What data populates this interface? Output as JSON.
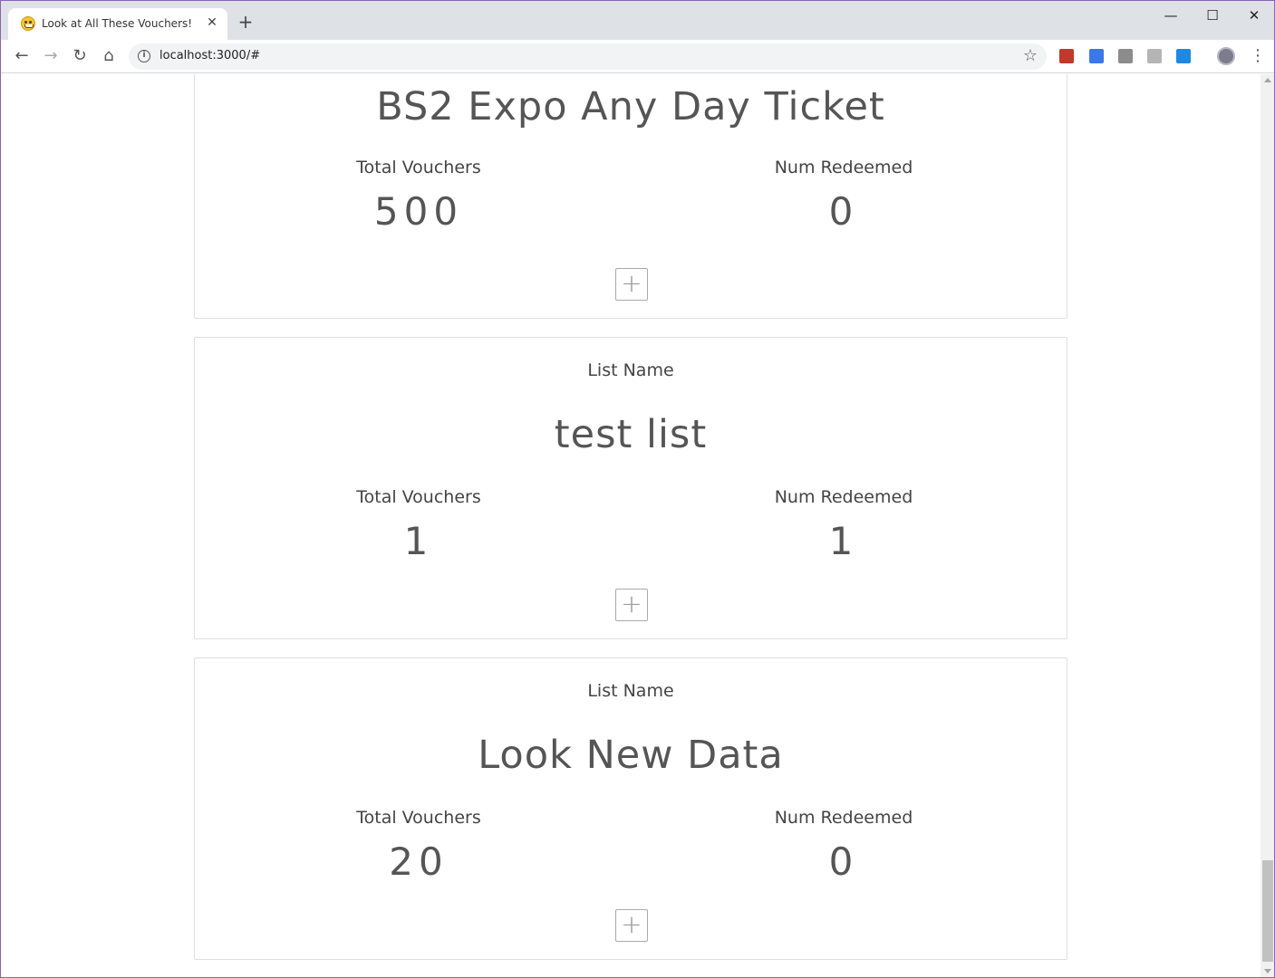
{
  "browser": {
    "tab_title": "Look at All These Vouchers!",
    "tab_close": "✕",
    "new_tab": "+",
    "url": "localhost:3000/#",
    "window_controls": {
      "minimize": "—",
      "maximize": "☐",
      "close": "✕"
    },
    "nav": {
      "back": "←",
      "forward": "→",
      "reload": "↻",
      "home": "⌂"
    },
    "info_icon": "i",
    "star_icon": "☆",
    "menu": "⋮",
    "extensions": [
      {
        "name": "ext-red-icon",
        "color": "#c0392b"
      },
      {
        "name": "ext-blue-icon",
        "color": "#3b78e7"
      },
      {
        "name": "ext-gray-icon",
        "color": "#8c8c8c"
      },
      {
        "name": "ext-light-gray-icon",
        "color": "#b5b5b5"
      },
      {
        "name": "ext-cyan-icon",
        "color": "#1e88e5"
      }
    ]
  },
  "cards": [
    {
      "title": "BS2 Expo Any Day Ticket",
      "total_label": "Total Vouchers",
      "total_value": "500",
      "redeemed_label": "Num Redeemed",
      "redeemed_value": "0",
      "add_label": "+"
    },
    {
      "list_label": "List Name",
      "title": "test list",
      "total_label": "Total Vouchers",
      "total_value": "1",
      "redeemed_label": "Num Redeemed",
      "redeemed_value": "1",
      "add_label": "+"
    },
    {
      "list_label": "List Name",
      "title": "Look New Data",
      "total_label": "Total Vouchers",
      "total_value": "20",
      "redeemed_label": "Num Redeemed",
      "redeemed_value": "0",
      "add_label": "+"
    }
  ]
}
